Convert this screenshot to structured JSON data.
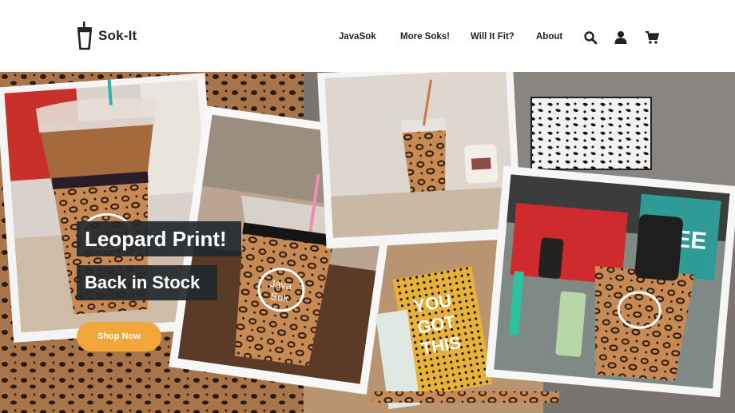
{
  "brand": {
    "name": "Sok-It"
  },
  "nav": {
    "items": [
      {
        "label": "JavaSok"
      },
      {
        "label": "More Soks!"
      },
      {
        "label": "Will It Fit?"
      },
      {
        "label": "About"
      }
    ],
    "icons": [
      "search-icon",
      "account-icon",
      "cart-icon"
    ]
  },
  "hero": {
    "headline": "Leopard Print!",
    "subheadline": "Back in Stock",
    "cta_label": "Shop Now",
    "sleeve_logo_text": "Java Sok",
    "notebook_text": "YOU GOT THIS",
    "tag_text": "LEE"
  },
  "colors": {
    "accent": "#f2a73a",
    "banner_bg": "#22282c",
    "text": "#222222"
  }
}
